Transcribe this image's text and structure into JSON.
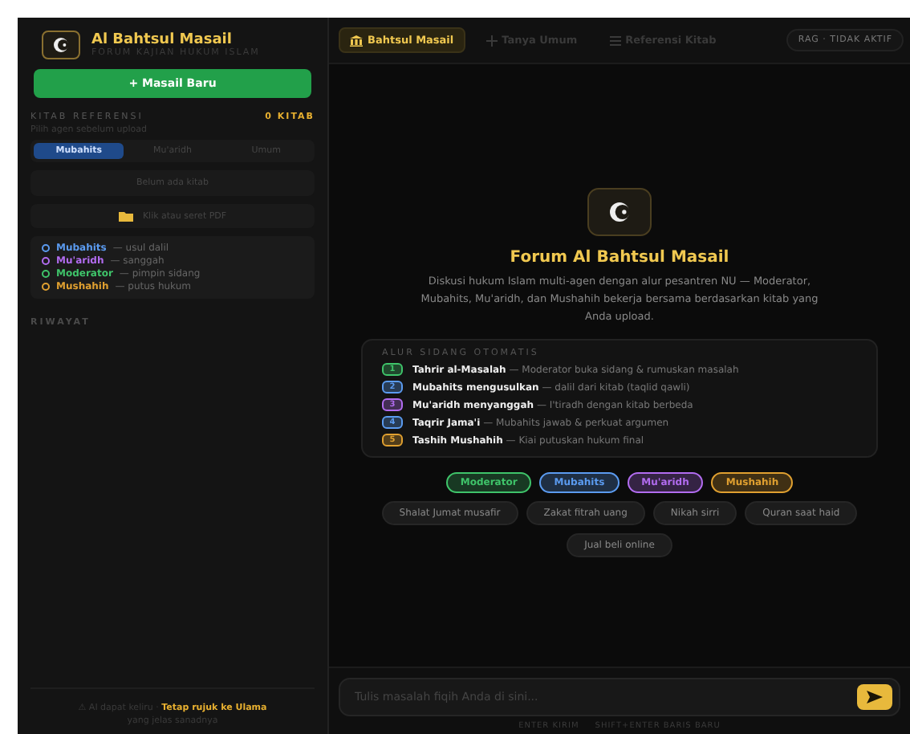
{
  "sidebar": {
    "brand": {
      "title": "Al Bahtsul Masail",
      "subtitle": "FORUM KAJIAN HUKUM ISLAM"
    },
    "new_button": "+ Masail Baru",
    "references": {
      "title": "KITAB REFERENSI",
      "count": "0 KITAB",
      "hint": "Pilih agen sebelum upload",
      "agent_tabs": [
        {
          "label": "Mubahits",
          "selected": true
        },
        {
          "label": "Mu'aridh",
          "selected": false
        },
        {
          "label": "Umum",
          "selected": false
        }
      ],
      "empty": "Belum ada kitab",
      "upload": "Klik atau seret PDF",
      "legend": [
        {
          "name": "Mubahits",
          "desc": "— usul dalil",
          "color": "#5b9bf0"
        },
        {
          "name": "Mu'aridh",
          "desc": "— sanggah",
          "color": "#b26cf0"
        },
        {
          "name": "Moderator",
          "desc": "— pimpin sidang",
          "color": "#3fc46a"
        },
        {
          "name": "Mushahih",
          "desc": "— putus hukum",
          "color": "#e0a030"
        }
      ]
    },
    "history_title": "RIWAYAT",
    "footer": "⚠ AI dapat keliru · **Tetap rujuk ke Ulama** yang jelas sanadnya"
  },
  "main": {
    "tabs": [
      {
        "label": "Bahtsul Masail",
        "kind": "building",
        "selected": true
      },
      {
        "label": "Tanya Umum",
        "kind": "plus",
        "selected": false
      },
      {
        "label": "Referensi Kitab",
        "kind": "list",
        "selected": false
      }
    ],
    "status": "RAG · TIDAK AKTIF",
    "hero": {
      "title": "Forum Al Bahtsul Masail",
      "description": "Diskusi hukum Islam multi-agen dengan alur pesantren NU — Moderator, Mubahits, Mu'aridh, dan Mushahih bekerja bersama berdasarkan kitab yang Anda upload."
    },
    "flow": {
      "title": "ALUR SIDANG OTOMATIS",
      "steps": [
        {
          "number": "1",
          "title": "Tahrir al-Masalah",
          "desc": "— Moderator buka sidang & rumuskan masalah",
          "color": "#3fc46a"
        },
        {
          "number": "2",
          "title": "Mubahits mengusulkan",
          "desc": "— dalil dari kitab (taqlid qawli)",
          "color": "#5b9bf0"
        },
        {
          "number": "3",
          "title": "Mu'aridh menyanggah",
          "desc": "— I'tiradh dengan kitab berbeda",
          "color": "#b26cf0"
        },
        {
          "number": "4",
          "title": "Taqrir Jama'i",
          "desc": "— Mubahits jawab & perkuat argumen",
          "color": "#5b9bf0"
        },
        {
          "number": "5",
          "title": "Tashih Mushahih",
          "desc": "— Kiai putuskan hukum final",
          "color": "#e0a030"
        }
      ]
    },
    "roles": [
      {
        "label": "Moderator",
        "color": "#3fc46a"
      },
      {
        "label": "Mubahits",
        "color": "#5b9bf0"
      },
      {
        "label": "Mu'aridh",
        "color": "#b26cf0"
      },
      {
        "label": "Mushahih",
        "color": "#e0a030"
      }
    ],
    "topics": [
      "Shalat Jumat musafir",
      "Zakat fitrah uang",
      "Nikah sirri",
      "Quran saat haid",
      "Jual beli online"
    ],
    "input": {
      "placeholder": "Tulis masalah fiqih Anda di sini..."
    },
    "hints": [
      "ENTER KIRIM",
      "SHIFT+ENTER BARIS BARU"
    ]
  }
}
